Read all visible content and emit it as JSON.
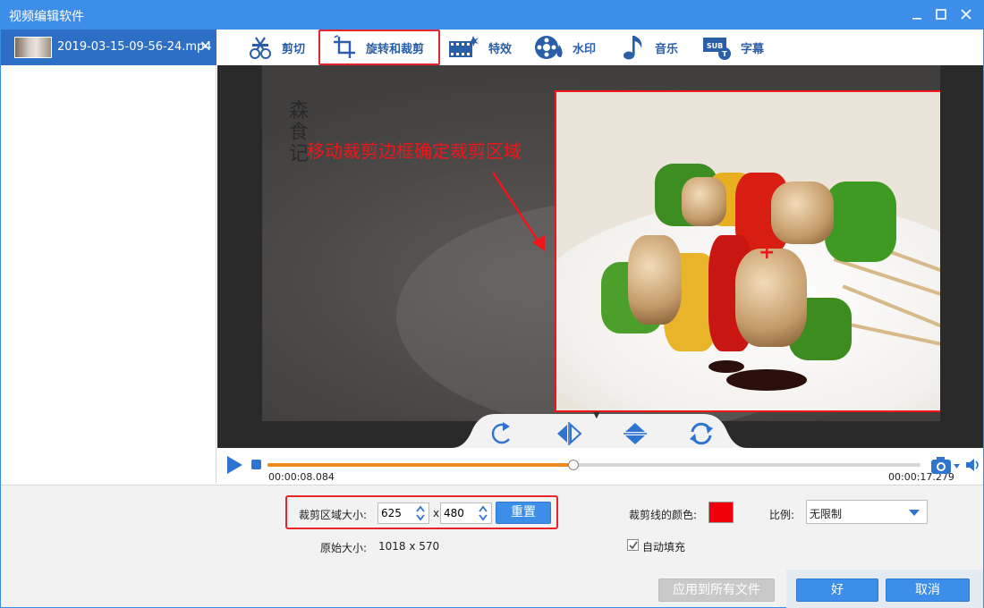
{
  "window": {
    "title": "视频编辑软件"
  },
  "file_list": {
    "items": [
      {
        "name": "2019-03-15-09-56-24.mp4"
      }
    ]
  },
  "toolbar": {
    "tools": [
      {
        "label": "剪切",
        "icon": "scissors-icon"
      },
      {
        "label": "旋转和裁剪",
        "icon": "rotate-crop-icon",
        "active": true
      },
      {
        "label": "特效",
        "icon": "effects-icon"
      },
      {
        "label": "水印",
        "icon": "watermark-icon"
      },
      {
        "label": "音乐",
        "icon": "music-note-icon"
      },
      {
        "label": "字幕",
        "icon": "subtitle-icon"
      }
    ]
  },
  "preview": {
    "annotation": "移动裁剪边框确定裁剪区域",
    "watermark_text": "森食记"
  },
  "playback": {
    "current_time": "00:00:08.084",
    "total_time": "00:00:17.279",
    "progress": 0.468
  },
  "crop": {
    "size_label": "裁剪区域大小:",
    "width": "625",
    "separator": "x",
    "height": "480",
    "reset_label": "重置",
    "original_size_label": "原始大小:",
    "original_size": "1018 x 570",
    "line_color_label": "裁剪线的颜色:",
    "line_color": "#f0000a",
    "ratio_label": "比例:",
    "ratio_value": "无限制",
    "auto_fill_label": "自动填充",
    "auto_fill_checked": true
  },
  "actions": {
    "apply_all_label": "应用到所有文件",
    "ok_label": "好",
    "cancel_label": "取消"
  },
  "colors": {
    "accent": "#3d8ee9",
    "highlight": "#e8252a",
    "progress": "#ef8a1a"
  }
}
